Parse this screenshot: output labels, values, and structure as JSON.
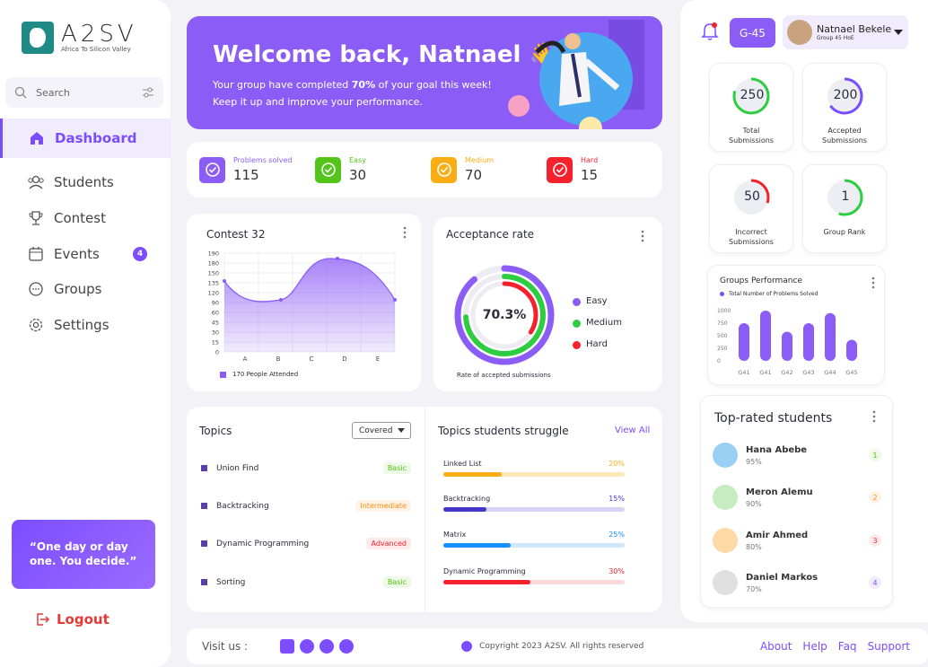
{
  "brand": {
    "name": "A2SV",
    "tagline": "Africa To Silicon Valley"
  },
  "search": {
    "label": "Search"
  },
  "nav": [
    {
      "label": "Dashboard"
    },
    {
      "label": "Students"
    },
    {
      "label": "Contest"
    },
    {
      "label": "Events",
      "badge": "4"
    },
    {
      "label": "Groups"
    },
    {
      "label": "Settings"
    }
  ],
  "quote": "“One day or day one. You decide.”",
  "logout": "Logout",
  "welcome": {
    "title": "Welcome back, Natnael",
    "line1_pre": "Your group have completed",
    "line1_pct": "70%",
    "line1_post": "of your goal this week!",
    "line2": "Keep it up and improve your performance."
  },
  "stats": [
    {
      "label": "Problems solved",
      "value": "115",
      "color": "#8c5cf6"
    },
    {
      "label": "Easy",
      "value": "30",
      "color": "#52c41a"
    },
    {
      "label": "Medium",
      "value": "70",
      "color": "#faad14"
    },
    {
      "label": "Hard",
      "value": "15",
      "color": "#f5222d"
    }
  ],
  "contest": {
    "title": "Contest 32",
    "legend": "170 People Attended",
    "yticks": [
      "190",
      "180",
      "150",
      "135",
      "120",
      "90",
      "60",
      "45",
      "30",
      "15",
      "0"
    ],
    "xticks": [
      "A",
      "B",
      "C",
      "D",
      "E"
    ]
  },
  "acceptance": {
    "title": "Acceptance rate",
    "center": "70.3%",
    "caption": "Rate of accepted submissions",
    "legend": [
      {
        "label": "Easy",
        "color": "#8c5cf6"
      },
      {
        "label": "Medium",
        "color": "#2ecc40"
      },
      {
        "label": "Hard",
        "color": "#f5222d"
      }
    ]
  },
  "topics": {
    "title": "Topics",
    "filter": "Covered",
    "items": [
      {
        "name": "Union Find",
        "tag": "Basic",
        "tag_color": "#52c41a",
        "tag_bg": "#eef9e6"
      },
      {
        "name": "Backtracking",
        "tag": "Intermediate",
        "tag_color": "#fa8c16",
        "tag_bg": "#fff3e6"
      },
      {
        "name": "Dynamic Programming",
        "tag": "Advanced",
        "tag_color": "#f5222d",
        "tag_bg": "#ffeaea"
      },
      {
        "name": "Sorting",
        "tag": "Basic",
        "tag_color": "#52c41a",
        "tag_bg": "#eef9e6"
      }
    ]
  },
  "struggle": {
    "title": "Topics students struggle",
    "view_all": "View All",
    "items": [
      {
        "name": "Linked List",
        "pct": "20%",
        "fraction": 0.32,
        "color": "#faad14",
        "bg": "#fde9b8"
      },
      {
        "name": "Backtracking",
        "pct": "15%",
        "fraction": 0.24,
        "color": "#4338ca",
        "bg": "#d6d3f5"
      },
      {
        "name": "Matrix",
        "pct": "25%",
        "fraction": 0.37,
        "color": "#1890ff",
        "bg": "#cfe6fb"
      },
      {
        "name": "Dynamic Programming",
        "pct": "30%",
        "fraction": 0.48,
        "color": "#f5222d",
        "bg": "#fcd9d9"
      }
    ]
  },
  "header": {
    "group_badge": "G-45",
    "user_name": "Natnael Bekele",
    "user_sub": "Group 45 HoE"
  },
  "submissions": [
    {
      "value": "250",
      "label": "Total Submissions",
      "color": "#2ecc40",
      "fill": 0.8
    },
    {
      "value": "200",
      "label": "Accepted Submissions",
      "color": "#7c4dff",
      "fill": 0.65
    },
    {
      "value": "50",
      "label": "Incorrect Submissions",
      "color": "#f5222d",
      "fill": 0.3
    },
    {
      "value": "1",
      "label": "Group Rank",
      "color": "#2ecc40",
      "fill": 0.55
    }
  ],
  "groups_perf": {
    "title": "Groups Performance",
    "legend": "Total Number of Problems Solved",
    "yticks": [
      "1000",
      "750",
      "500",
      "250",
      "0"
    ],
    "categories": [
      "G41",
      "G41",
      "G42",
      "G43",
      "G44",
      "G45"
    ],
    "values": [
      750,
      1000,
      580,
      750,
      950,
      420
    ]
  },
  "top_students": {
    "title": "Top-rated students",
    "items": [
      {
        "name": "Hana Abebe",
        "pct": "95%",
        "rank": "1",
        "rank_color": "#52c41a",
        "rank_bg": "#eef9e6",
        "avatar": "#9bd0f5"
      },
      {
        "name": "Meron Alemu",
        "pct": "90%",
        "rank": "2",
        "rank_color": "#fa8c16",
        "rank_bg": "#fff3e6",
        "avatar": "#c7ecc1"
      },
      {
        "name": "Amir Ahmed",
        "pct": "80%",
        "rank": "3",
        "rank_color": "#f5222d",
        "rank_bg": "#ffeaea",
        "avatar": "#fcd9a5"
      },
      {
        "name": "Daniel Markos",
        "pct": "70%",
        "rank": "4",
        "rank_color": "#7c4dff",
        "rank_bg": "#f0ecfd",
        "avatar": "#e0e0e0"
      }
    ]
  },
  "footer": {
    "visit": "Visit us :",
    "copyright": "Copyright 2023 A2SV. All rights reserved",
    "links": [
      "About",
      "Help",
      "Faq",
      "Support"
    ]
  },
  "colors": {
    "accent": "#7c4dff",
    "banner": "#8c5cf6"
  }
}
